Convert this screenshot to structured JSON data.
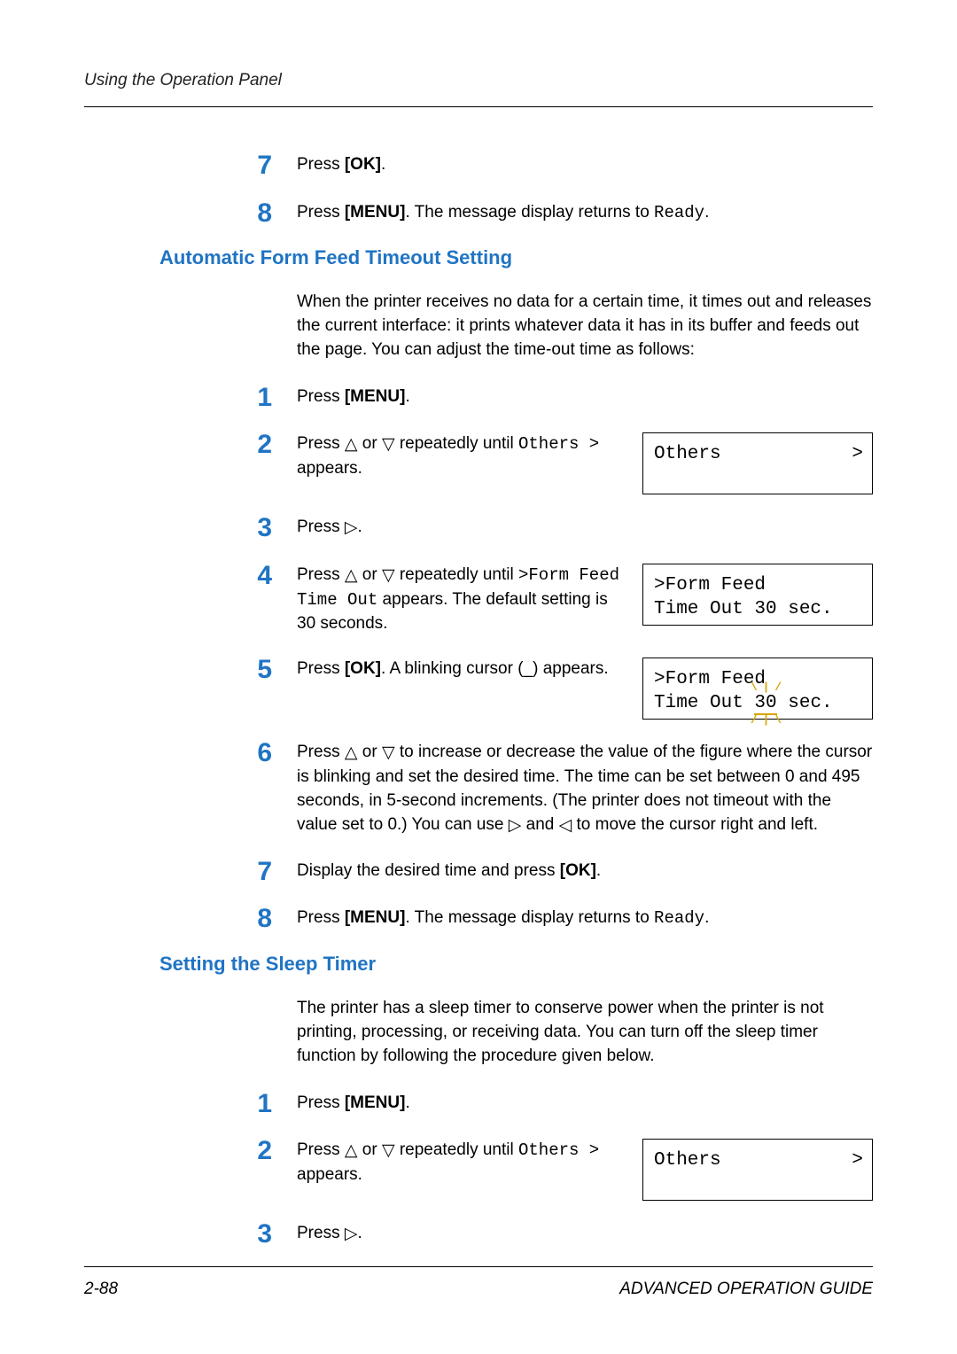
{
  "header": {
    "running": "Using the Operation Panel"
  },
  "prelude": {
    "s7": {
      "num": "7",
      "text_a": "Press ",
      "ok": "[OK]",
      "text_b": "."
    },
    "s8": {
      "num": "8",
      "text_a": "Press ",
      "menu": "[MENU]",
      "text_b": ". The message display returns to ",
      "ready": "Ready",
      "text_c": "."
    }
  },
  "sec1": {
    "title": "Automatic Form Feed Timeout Setting",
    "intro": "When the printer receives no data for a certain time, it times out and releases the current interface: it prints whatever data it has in its buffer and feeds out the page. You can adjust the time-out time as follows:",
    "s1": {
      "num": "1",
      "a": "Press ",
      "menu": "[MENU]",
      "b": "."
    },
    "s2": {
      "num": "2",
      "a": "Press ",
      "b": " or ",
      "c": " repeatedly until ",
      "others": "Others >",
      "d": " appears.",
      "lcd": {
        "l1": "Others",
        "gt": ">"
      }
    },
    "s3": {
      "num": "3",
      "a": "Press ",
      "b": "."
    },
    "s4": {
      "num": "4",
      "a": "Press ",
      "b": " or ",
      "c": " repeatedly until ",
      "code1": ">Form Feed Time Out",
      "d": " appears. The default setting is 30 seconds.",
      "lcd": {
        "l1": ">Form Feed",
        "l2": "Time Out 30 sec."
      }
    },
    "s5": {
      "num": "5",
      "a": "Press ",
      "ok": "[OK]",
      "b": ". A blinking cursor (_) appears.",
      "lcd": {
        "l1": ">Form Feed",
        "l2a": "Time Out ",
        "val": "30",
        "l2b": " sec."
      }
    },
    "s6": {
      "num": "6",
      "a": "Press ",
      "b": " or ",
      "c": " to increase or decrease the value of the figure where the cursor is blinking and set the desired time. The time can be set between 0 and 495 seconds, in 5-second increments. (The printer does not timeout with the value set to 0.) You can use ",
      "d": " and ",
      "e": " to move the cursor right and left."
    },
    "s7": {
      "num": "7",
      "a": "Display the desired time and press ",
      "ok": "[OK]",
      "b": "."
    },
    "s8": {
      "num": "8",
      "a": "Press ",
      "menu": "[MENU]",
      "b": ". The message display returns to ",
      "ready": "Ready",
      "c": "."
    }
  },
  "sec2": {
    "title": "Setting the Sleep Timer",
    "intro": "The printer has a sleep timer to conserve power when the printer is not printing, processing, or receiving data. You can turn off the sleep timer function by following the procedure given below.",
    "s1": {
      "num": "1",
      "a": "Press ",
      "menu": "[MENU]",
      "b": "."
    },
    "s2": {
      "num": "2",
      "a": "Press ",
      "b": " or ",
      "c": " repeatedly until ",
      "others": "Others >",
      "d": " appears.",
      "lcd": {
        "l1": "Others",
        "gt": ">"
      }
    },
    "s3": {
      "num": "3",
      "a": "Press ",
      "b": "."
    }
  },
  "footer": {
    "page": "2-88",
    "guide": "ADVANCED OPERATION GUIDE"
  },
  "glyph": {
    "up": "△",
    "down": "▽",
    "right": "▷",
    "left": "◁"
  }
}
